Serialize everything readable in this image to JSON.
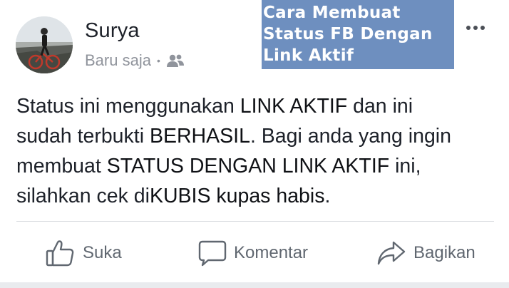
{
  "post": {
    "author_name": "Surya",
    "timestamp": "Baru saja",
    "separator": "•",
    "audience_icon": "friends-icon",
    "body": {
      "line1": {
        "t1": "Status ini menggunakan ",
        "b1": "LINK AKTIF",
        "t2": " dan ini"
      },
      "line2": {
        "t1": "sudah terbukti ",
        "b1": "BERHASIL",
        "t2": ". Bagi anda yang ingin"
      },
      "line3": {
        "t1": "membuat ",
        "b1": "STATUS DENGAN LINK AKTIF",
        "t2": " ini,"
      },
      "line4": {
        "t1": "silahkan cek di",
        "link": "KUBIS kupas habis",
        "t2": "."
      }
    }
  },
  "overlay": {
    "lines": [
      "Cara Membuat",
      "Status FB Dengan",
      "Link Aktif"
    ],
    "color": "#6e8fbf"
  },
  "actions": {
    "like": "Suka",
    "comment": "Komentar",
    "share": "Bagikan"
  },
  "colors": {
    "text_primary": "#1d2129",
    "text_secondary": "#90949c",
    "action_text": "#606770",
    "divider": "#dadde1"
  }
}
